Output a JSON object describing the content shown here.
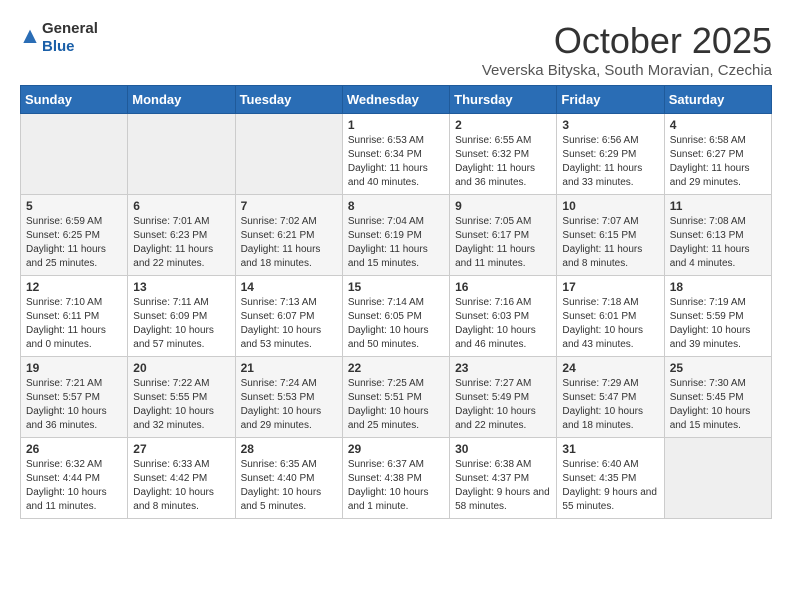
{
  "header": {
    "logo_general": "General",
    "logo_blue": "Blue",
    "month_title": "October 2025",
    "subtitle": "Veverska Bityska, South Moravian, Czechia"
  },
  "weekdays": [
    "Sunday",
    "Monday",
    "Tuesday",
    "Wednesday",
    "Thursday",
    "Friday",
    "Saturday"
  ],
  "weeks": [
    [
      {
        "day": "",
        "info": ""
      },
      {
        "day": "",
        "info": ""
      },
      {
        "day": "",
        "info": ""
      },
      {
        "day": "1",
        "info": "Sunrise: 6:53 AM\nSunset: 6:34 PM\nDaylight: 11 hours and 40 minutes."
      },
      {
        "day": "2",
        "info": "Sunrise: 6:55 AM\nSunset: 6:32 PM\nDaylight: 11 hours and 36 minutes."
      },
      {
        "day": "3",
        "info": "Sunrise: 6:56 AM\nSunset: 6:29 PM\nDaylight: 11 hours and 33 minutes."
      },
      {
        "day": "4",
        "info": "Sunrise: 6:58 AM\nSunset: 6:27 PM\nDaylight: 11 hours and 29 minutes."
      }
    ],
    [
      {
        "day": "5",
        "info": "Sunrise: 6:59 AM\nSunset: 6:25 PM\nDaylight: 11 hours and 25 minutes."
      },
      {
        "day": "6",
        "info": "Sunrise: 7:01 AM\nSunset: 6:23 PM\nDaylight: 11 hours and 22 minutes."
      },
      {
        "day": "7",
        "info": "Sunrise: 7:02 AM\nSunset: 6:21 PM\nDaylight: 11 hours and 18 minutes."
      },
      {
        "day": "8",
        "info": "Sunrise: 7:04 AM\nSunset: 6:19 PM\nDaylight: 11 hours and 15 minutes."
      },
      {
        "day": "9",
        "info": "Sunrise: 7:05 AM\nSunset: 6:17 PM\nDaylight: 11 hours and 11 minutes."
      },
      {
        "day": "10",
        "info": "Sunrise: 7:07 AM\nSunset: 6:15 PM\nDaylight: 11 hours and 8 minutes."
      },
      {
        "day": "11",
        "info": "Sunrise: 7:08 AM\nSunset: 6:13 PM\nDaylight: 11 hours and 4 minutes."
      }
    ],
    [
      {
        "day": "12",
        "info": "Sunrise: 7:10 AM\nSunset: 6:11 PM\nDaylight: 11 hours and 0 minutes."
      },
      {
        "day": "13",
        "info": "Sunrise: 7:11 AM\nSunset: 6:09 PM\nDaylight: 10 hours and 57 minutes."
      },
      {
        "day": "14",
        "info": "Sunrise: 7:13 AM\nSunset: 6:07 PM\nDaylight: 10 hours and 53 minutes."
      },
      {
        "day": "15",
        "info": "Sunrise: 7:14 AM\nSunset: 6:05 PM\nDaylight: 10 hours and 50 minutes."
      },
      {
        "day": "16",
        "info": "Sunrise: 7:16 AM\nSunset: 6:03 PM\nDaylight: 10 hours and 46 minutes."
      },
      {
        "day": "17",
        "info": "Sunrise: 7:18 AM\nSunset: 6:01 PM\nDaylight: 10 hours and 43 minutes."
      },
      {
        "day": "18",
        "info": "Sunrise: 7:19 AM\nSunset: 5:59 PM\nDaylight: 10 hours and 39 minutes."
      }
    ],
    [
      {
        "day": "19",
        "info": "Sunrise: 7:21 AM\nSunset: 5:57 PM\nDaylight: 10 hours and 36 minutes."
      },
      {
        "day": "20",
        "info": "Sunrise: 7:22 AM\nSunset: 5:55 PM\nDaylight: 10 hours and 32 minutes."
      },
      {
        "day": "21",
        "info": "Sunrise: 7:24 AM\nSunset: 5:53 PM\nDaylight: 10 hours and 29 minutes."
      },
      {
        "day": "22",
        "info": "Sunrise: 7:25 AM\nSunset: 5:51 PM\nDaylight: 10 hours and 25 minutes."
      },
      {
        "day": "23",
        "info": "Sunrise: 7:27 AM\nSunset: 5:49 PM\nDaylight: 10 hours and 22 minutes."
      },
      {
        "day": "24",
        "info": "Sunrise: 7:29 AM\nSunset: 5:47 PM\nDaylight: 10 hours and 18 minutes."
      },
      {
        "day": "25",
        "info": "Sunrise: 7:30 AM\nSunset: 5:45 PM\nDaylight: 10 hours and 15 minutes."
      }
    ],
    [
      {
        "day": "26",
        "info": "Sunrise: 6:32 AM\nSunset: 4:44 PM\nDaylight: 10 hours and 11 minutes."
      },
      {
        "day": "27",
        "info": "Sunrise: 6:33 AM\nSunset: 4:42 PM\nDaylight: 10 hours and 8 minutes."
      },
      {
        "day": "28",
        "info": "Sunrise: 6:35 AM\nSunset: 4:40 PM\nDaylight: 10 hours and 5 minutes."
      },
      {
        "day": "29",
        "info": "Sunrise: 6:37 AM\nSunset: 4:38 PM\nDaylight: 10 hours and 1 minute."
      },
      {
        "day": "30",
        "info": "Sunrise: 6:38 AM\nSunset: 4:37 PM\nDaylight: 9 hours and 58 minutes."
      },
      {
        "day": "31",
        "info": "Sunrise: 6:40 AM\nSunset: 4:35 PM\nDaylight: 9 hours and 55 minutes."
      },
      {
        "day": "",
        "info": ""
      }
    ]
  ]
}
